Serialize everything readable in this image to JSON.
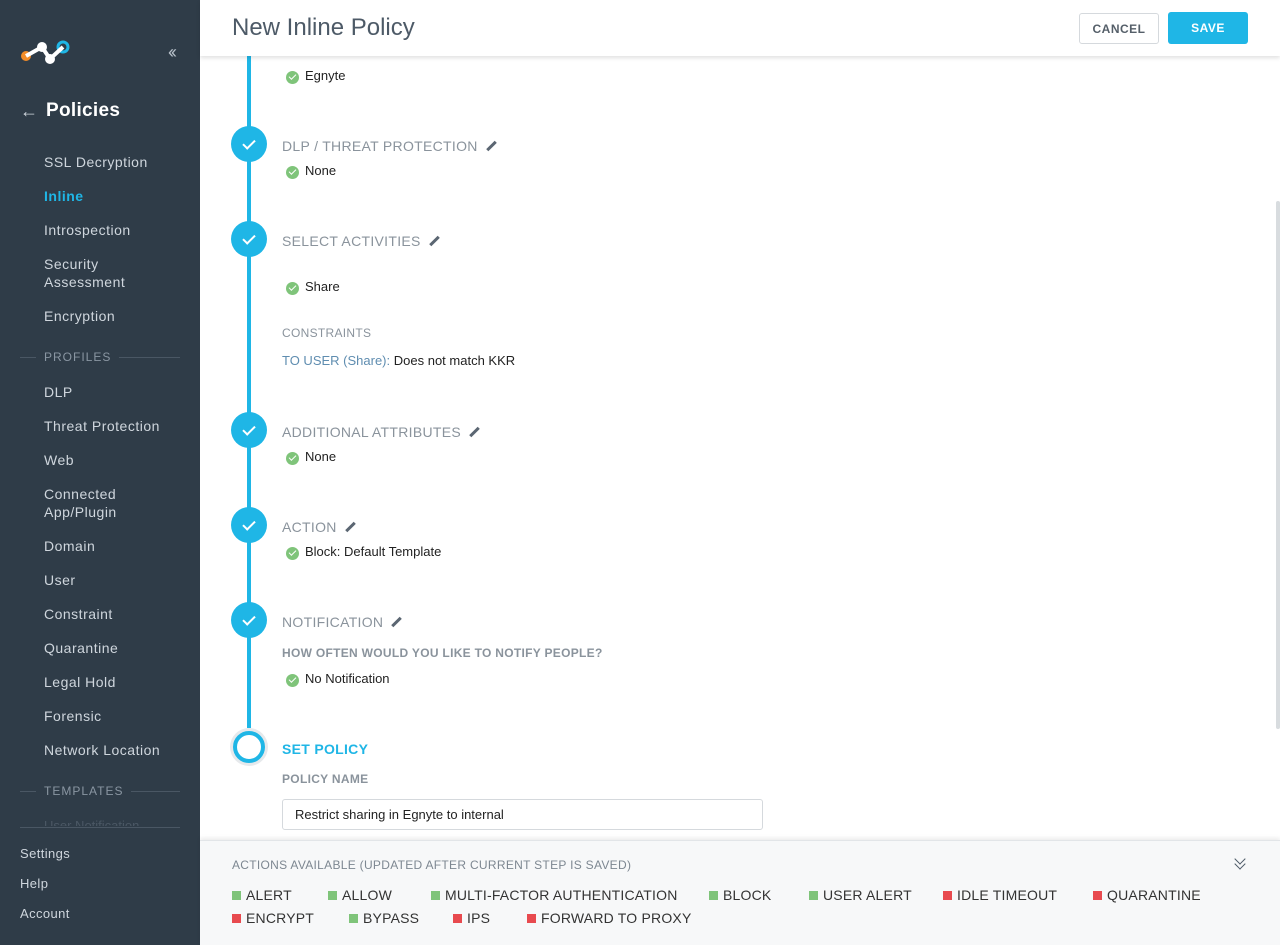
{
  "sidebar": {
    "back_title": "Policies",
    "nav": [
      {
        "label": "SSL Decryption",
        "active": false
      },
      {
        "label": "Inline",
        "active": true
      },
      {
        "label": "Introspection",
        "active": false
      },
      {
        "label": "Security Assessment",
        "active": false
      },
      {
        "label": "Encryption",
        "active": false
      }
    ],
    "profiles_section": "PROFILES",
    "profiles": [
      "DLP",
      "Threat Protection",
      "Web",
      "Connected App/Plugin",
      "Domain",
      "User",
      "Constraint",
      "Quarantine",
      "Legal Hold",
      "Forensic",
      "Network Location"
    ],
    "templates_section": "TEMPLATES",
    "faded_item": "User Notification",
    "bottom": [
      "Settings",
      "Help",
      "Account"
    ]
  },
  "header": {
    "title": "New Inline Policy",
    "cancel_label": "CANCEL",
    "save_label": "SAVE"
  },
  "steps": {
    "app_value": "Egnyte",
    "dlp": {
      "title": "DLP / THREAT PROTECTION",
      "value": "None"
    },
    "activities": {
      "title": "SELECT ACTIVITIES",
      "value": "Share",
      "constraints_label": "CONSTRAINTS",
      "constraint_key": "TO USER (Share):",
      "constraint_value": "Does not match KKR"
    },
    "attributes": {
      "title": "ADDITIONAL ATTRIBUTES",
      "value": "None"
    },
    "action": {
      "title": "ACTION",
      "value": "Block: Default Template"
    },
    "notification": {
      "title": "NOTIFICATION",
      "question": "HOW OFTEN WOULD YOU LIKE TO NOTIFY PEOPLE?",
      "value": "No Notification"
    },
    "set_policy": {
      "title": "SET POLICY",
      "name_label": "POLICY NAME",
      "name_value": "Restrict sharing in Egnyte to internal"
    }
  },
  "footer": {
    "title": "ACTIONS AVAILABLE (UPDATED AFTER CURRENT STEP IS SAVED)",
    "actions": [
      {
        "label": "ALERT",
        "status": "available"
      },
      {
        "label": "ALLOW",
        "status": "available"
      },
      {
        "label": "MULTI-FACTOR AUTHENTICATION",
        "status": "available"
      },
      {
        "label": "BLOCK",
        "status": "available"
      },
      {
        "label": "USER ALERT",
        "status": "available"
      },
      {
        "label": "IDLE TIMEOUT",
        "status": "unavailable"
      },
      {
        "label": "QUARANTINE",
        "status": "unavailable"
      },
      {
        "label": "ENCRYPT",
        "status": "unavailable"
      },
      {
        "label": "BYPASS",
        "status": "available"
      },
      {
        "label": "IPS",
        "status": "unavailable"
      },
      {
        "label": "FORWARD TO PROXY",
        "status": "unavailable"
      }
    ]
  },
  "colors": {
    "accent": "#1fb6e6",
    "sidebar_bg": "#2f3c48",
    "available": "#7fc47a",
    "unavailable": "#e84a4f"
  }
}
